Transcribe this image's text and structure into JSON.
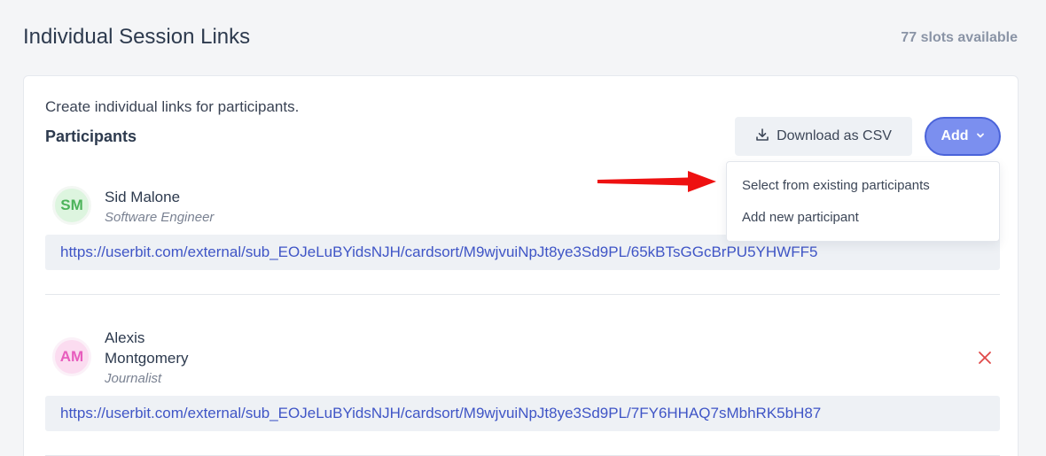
{
  "header": {
    "title": "Individual Session Links",
    "slots": "77 slots available"
  },
  "card": {
    "intro": "Create individual links for participants.",
    "heading": "Participants",
    "download_label": "Download as CSV",
    "add_label": "Add"
  },
  "dropdown": {
    "items": [
      {
        "label": "Select from existing participants"
      },
      {
        "label": "Add new participant"
      }
    ]
  },
  "participants": [
    {
      "initials": "SM",
      "name": "Sid Malone",
      "role": "Software Engineer",
      "link": "https://userbit.com/external/sub_EOJeLuBYidsNJH/cardsort/M9wjvuiNpJt8ye3Sd9PL/65kBTsGGcBrPU5YHWFF5"
    },
    {
      "initials": "AM",
      "name_line1": "Alexis",
      "name_line2": "Montgomery",
      "role": "Journalist",
      "link": "https://userbit.com/external/sub_EOJeLuBYidsNJH/cardsort/M9wjvuiNpJt8ye3Sd9PL/7FY6HHAQ7sMbhRK5bH87"
    }
  ],
  "icons": {
    "download": "download-icon",
    "chevron": "chevron-down-icon",
    "remove": "close-icon",
    "arrow": "arrow-right-icon"
  },
  "colors": {
    "accent": "#7b8fef",
    "link": "#3f55c6",
    "remove": "#e04848",
    "arrow": "#ee1111"
  }
}
